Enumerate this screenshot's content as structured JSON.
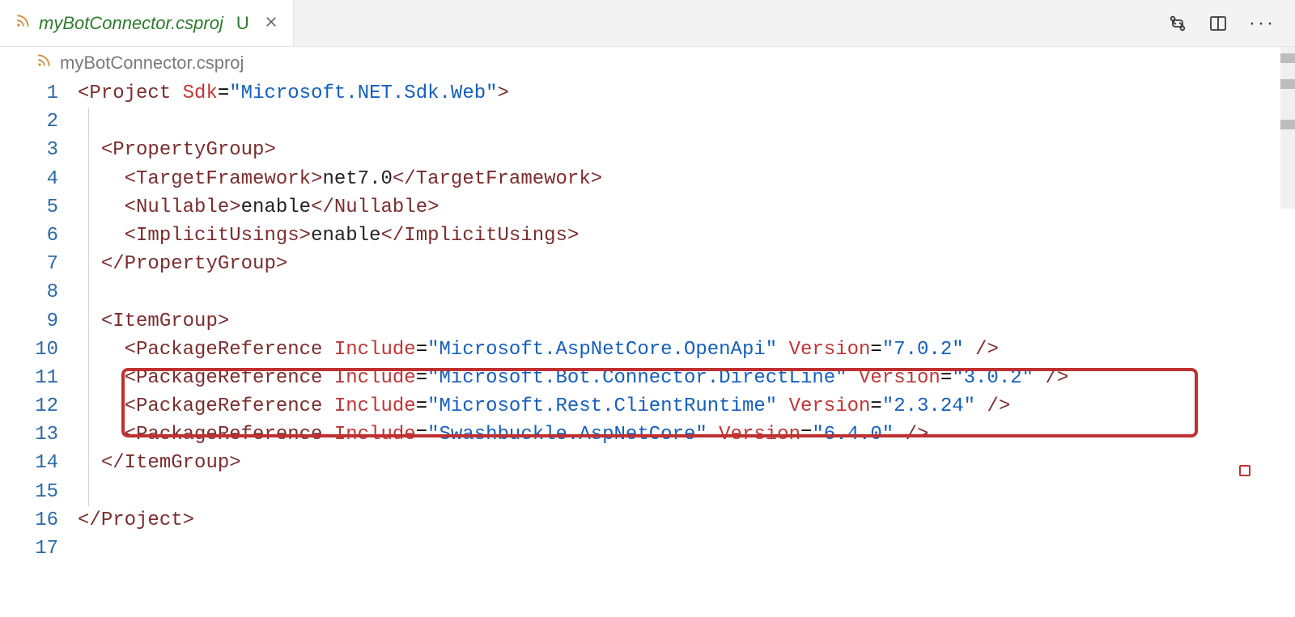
{
  "tab": {
    "filename": "myBotConnector.csproj",
    "modified_marker": "U"
  },
  "breadcrumb": {
    "filename": "myBotConnector.csproj"
  },
  "code": {
    "lines": [
      {
        "n": 1,
        "indent": 0,
        "tokens": [
          {
            "t": "punct",
            "v": "<"
          },
          {
            "t": "tag",
            "v": "Project"
          },
          {
            "t": "text",
            "v": " "
          },
          {
            "t": "attr",
            "v": "Sdk"
          },
          {
            "t": "eq",
            "v": "="
          },
          {
            "t": "string",
            "v": "\"Microsoft.NET.Sdk.Web\""
          },
          {
            "t": "punct",
            "v": ">"
          }
        ]
      },
      {
        "n": 2,
        "indent": 0,
        "tokens": []
      },
      {
        "n": 3,
        "indent": 1,
        "tokens": [
          {
            "t": "punct",
            "v": "<"
          },
          {
            "t": "tag",
            "v": "PropertyGroup"
          },
          {
            "t": "punct",
            "v": ">"
          }
        ]
      },
      {
        "n": 4,
        "indent": 2,
        "tokens": [
          {
            "t": "punct",
            "v": "<"
          },
          {
            "t": "tag",
            "v": "TargetFramework"
          },
          {
            "t": "punct",
            "v": ">"
          },
          {
            "t": "text",
            "v": "net7.0"
          },
          {
            "t": "punct",
            "v": "</"
          },
          {
            "t": "tag",
            "v": "TargetFramework"
          },
          {
            "t": "punct",
            "v": ">"
          }
        ]
      },
      {
        "n": 5,
        "indent": 2,
        "tokens": [
          {
            "t": "punct",
            "v": "<"
          },
          {
            "t": "tag",
            "v": "Nullable"
          },
          {
            "t": "punct",
            "v": ">"
          },
          {
            "t": "text",
            "v": "enable"
          },
          {
            "t": "punct",
            "v": "</"
          },
          {
            "t": "tag",
            "v": "Nullable"
          },
          {
            "t": "punct",
            "v": ">"
          }
        ]
      },
      {
        "n": 6,
        "indent": 2,
        "tokens": [
          {
            "t": "punct",
            "v": "<"
          },
          {
            "t": "tag",
            "v": "ImplicitUsings"
          },
          {
            "t": "punct",
            "v": ">"
          },
          {
            "t": "text",
            "v": "enable"
          },
          {
            "t": "punct",
            "v": "</"
          },
          {
            "t": "tag",
            "v": "ImplicitUsings"
          },
          {
            "t": "punct",
            "v": ">"
          }
        ]
      },
      {
        "n": 7,
        "indent": 1,
        "tokens": [
          {
            "t": "punct",
            "v": "</"
          },
          {
            "t": "tag",
            "v": "PropertyGroup"
          },
          {
            "t": "punct",
            "v": ">"
          }
        ]
      },
      {
        "n": 8,
        "indent": 0,
        "tokens": []
      },
      {
        "n": 9,
        "indent": 1,
        "tokens": [
          {
            "t": "punct",
            "v": "<"
          },
          {
            "t": "tag",
            "v": "ItemGroup"
          },
          {
            "t": "punct",
            "v": ">"
          }
        ]
      },
      {
        "n": 10,
        "indent": 2,
        "tokens": [
          {
            "t": "punct",
            "v": "<"
          },
          {
            "t": "tag",
            "v": "PackageReference"
          },
          {
            "t": "text",
            "v": " "
          },
          {
            "t": "attr",
            "v": "Include"
          },
          {
            "t": "eq",
            "v": "="
          },
          {
            "t": "string",
            "v": "\"Microsoft.AspNetCore.OpenApi\""
          },
          {
            "t": "text",
            "v": " "
          },
          {
            "t": "attr",
            "v": "Version"
          },
          {
            "t": "eq",
            "v": "="
          },
          {
            "t": "string",
            "v": "\"7.0.2\""
          },
          {
            "t": "text",
            "v": " "
          },
          {
            "t": "punct",
            "v": "/>"
          }
        ]
      },
      {
        "n": 11,
        "indent": 2,
        "tokens": [
          {
            "t": "punct",
            "v": "<"
          },
          {
            "t": "tag",
            "v": "PackageReference"
          },
          {
            "t": "text",
            "v": " "
          },
          {
            "t": "attr",
            "v": "Include"
          },
          {
            "t": "eq",
            "v": "="
          },
          {
            "t": "string",
            "v": "\"Microsoft.Bot.Connector.DirectLine\""
          },
          {
            "t": "text",
            "v": " "
          },
          {
            "t": "attr",
            "v": "Version"
          },
          {
            "t": "eq",
            "v": "="
          },
          {
            "t": "string",
            "v": "\"3.0.2\""
          },
          {
            "t": "text",
            "v": " "
          },
          {
            "t": "punct",
            "v": "/>"
          }
        ]
      },
      {
        "n": 12,
        "indent": 2,
        "tokens": [
          {
            "t": "punct",
            "v": "<"
          },
          {
            "t": "tag",
            "v": "PackageReference"
          },
          {
            "t": "text",
            "v": " "
          },
          {
            "t": "attr",
            "v": "Include"
          },
          {
            "t": "eq",
            "v": "="
          },
          {
            "t": "string",
            "v": "\"Microsoft.Rest.ClientRuntime\""
          },
          {
            "t": "text",
            "v": " "
          },
          {
            "t": "attr",
            "v": "Version"
          },
          {
            "t": "eq",
            "v": "="
          },
          {
            "t": "string",
            "v": "\"2.3.24\""
          },
          {
            "t": "text",
            "v": " "
          },
          {
            "t": "punct",
            "v": "/>"
          }
        ]
      },
      {
        "n": 13,
        "indent": 2,
        "tokens": [
          {
            "t": "punct",
            "v": "<"
          },
          {
            "t": "tag",
            "v": "PackageReference"
          },
          {
            "t": "text",
            "v": " "
          },
          {
            "t": "attr",
            "v": "Include"
          },
          {
            "t": "eq",
            "v": "="
          },
          {
            "t": "string",
            "v": "\"Swashbuckle.AspNetCore\""
          },
          {
            "t": "text",
            "v": " "
          },
          {
            "t": "attr",
            "v": "Version"
          },
          {
            "t": "eq",
            "v": "="
          },
          {
            "t": "string",
            "v": "\"6.4.0\""
          },
          {
            "t": "text",
            "v": " "
          },
          {
            "t": "punct",
            "v": "/>"
          }
        ]
      },
      {
        "n": 14,
        "indent": 1,
        "tokens": [
          {
            "t": "punct",
            "v": "</"
          },
          {
            "t": "tag",
            "v": "ItemGroup"
          },
          {
            "t": "punct",
            "v": ">"
          }
        ]
      },
      {
        "n": 15,
        "indent": 0,
        "tokens": []
      },
      {
        "n": 16,
        "indent": 0,
        "tokens": [
          {
            "t": "punct",
            "v": "</"
          },
          {
            "t": "tag",
            "v": "Project"
          },
          {
            "t": "punct",
            "v": ">"
          }
        ]
      },
      {
        "n": 17,
        "indent": 0,
        "tokens": []
      }
    ],
    "indent_unit": "  "
  },
  "icons": {
    "compare": "compare-changes-icon",
    "split": "split-editor-icon",
    "more": "more-actions-icon"
  }
}
